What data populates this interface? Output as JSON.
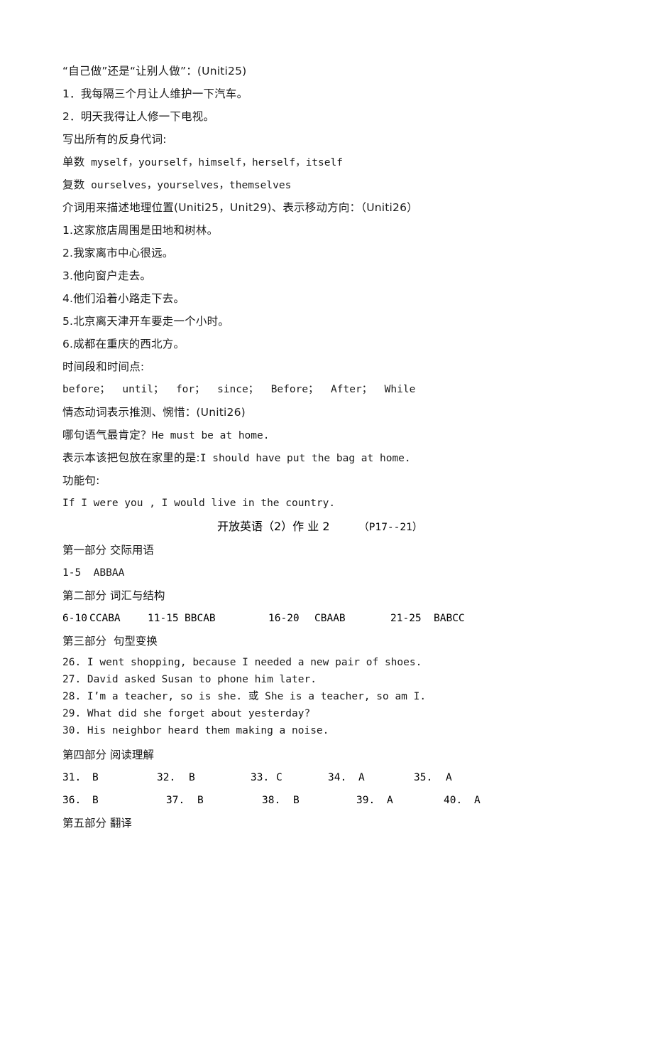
{
  "document": {
    "title": "开放英语（2）作 业 2",
    "page_range": "（P17--21）"
  },
  "notes": {
    "topic1": "“自己做”还是“让别人做”：(Uniti25)",
    "item1": "1．我每隔三个月让人维护一下汽车。",
    "item2": "2．明天我得让人修一下电视。",
    "reflexive_prompt": "写出所有的反身代词:",
    "singular_label": "单数",
    "singular_value": "myself，yourself，himself，herself，itself",
    "plural_label": "复数",
    "plural_value": "ourselves，yourselves，themselves",
    "topic2": "介词用来描述地理位置(Uniti25，Unit29)、表示移动方向：（Uniti26）",
    "prep_items": [
      "1.这家旅店周围是田地和树林。",
      "2.我家离市中心很远。",
      "3.他向窗户走去。",
      "4.他们沿着小路走下去。",
      "5.北京离天津开车要走一个小时。",
      "6.成都在重庆的西北方。"
    ],
    "time_label": "时间段和时间点:",
    "time_words": "before；  until；  for；  since；  Before；  After；  While",
    "modal_topic": "情态动词表示推测、惋惜：(Uniti26)",
    "modal_q_label": "哪句语气最肯定？",
    "modal_q_answer": "He must be at home.",
    "regret_label": "表示本该把包放在家里的是:",
    "regret_answer": "I should have put the bag at home.",
    "function_label": "功能句:",
    "function_sentence": "If I were you , I would live in the country."
  },
  "answer_key": {
    "part1_title": "第一部分 交际用语",
    "part1_answers": "1-5  ABBAA",
    "part2_title": "第二部分 词汇与结构",
    "part2_answers": [
      {
        "range": "6-10",
        "letters": "CCABA"
      },
      {
        "range": "11-15",
        "letters": "BBCAB"
      },
      {
        "range": "16-20",
        "letters": "CBAAB"
      },
      {
        "range": "21-25",
        "letters": "BABCC"
      }
    ],
    "part3_title": "第三部分  句型变换",
    "part3_items": [
      "26. I went shopping, because I needed a new pair of shoes.",
      "27. David asked Susan to phone him later.",
      "28. I’m a teacher, so is she. 或 She is a teacher, so am I.",
      "29. What did she forget about yesterday?",
      "30. His neighbor heard them making a noise."
    ],
    "part4_title": "第四部分 阅读理解",
    "part4_row1": [
      {
        "num": "31.",
        "letter": "B"
      },
      {
        "num": "32.",
        "letter": "B"
      },
      {
        "num": "33.",
        "letter": "C"
      },
      {
        "num": "34.",
        "letter": "A"
      },
      {
        "num": "35.",
        "letter": "A"
      }
    ],
    "part4_row2": [
      {
        "num": "36.",
        "letter": "B"
      },
      {
        "num": "37.",
        "letter": "B"
      },
      {
        "num": "38.",
        "letter": "B"
      },
      {
        "num": "39.",
        "letter": "A"
      },
      {
        "num": "40.",
        "letter": "A"
      }
    ],
    "part5_title": "第五部分 翻译"
  }
}
